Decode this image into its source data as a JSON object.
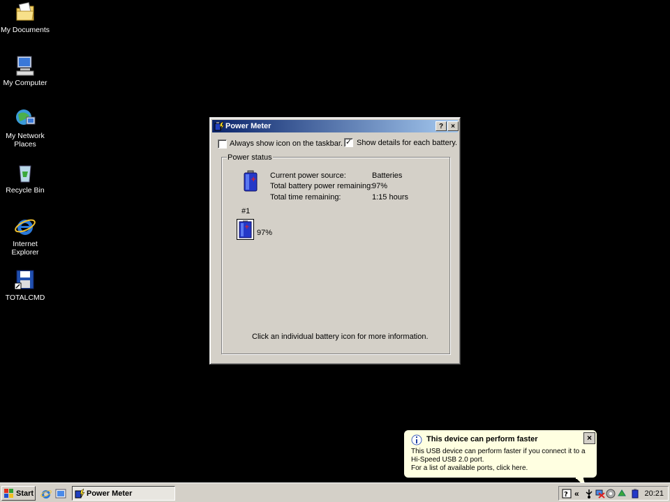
{
  "desktop": {
    "icons": [
      {
        "label": "My Documents"
      },
      {
        "label": "My Computer"
      },
      {
        "label": "My Network Places"
      },
      {
        "label": "Recycle Bin"
      },
      {
        "label": "Internet Explorer"
      },
      {
        "label": "TOTALCMD"
      }
    ]
  },
  "window": {
    "title": "Power Meter",
    "help_btn": "?",
    "close_btn": "×",
    "always_show_label": "Always show icon on the taskbar.",
    "always_show_checked": false,
    "show_details_label": "Show details for each battery.",
    "show_details_checked": true,
    "group_title": "Power status",
    "labels": {
      "source": "Current power source:",
      "remaining": "Total battery power remaining:",
      "time": "Total time remaining:"
    },
    "values": {
      "source": "Batteries",
      "remaining": "97%",
      "time": "1:15 hours"
    },
    "battery": {
      "number": "#1",
      "percent": "97%",
      "level": 0.97
    },
    "footer": "Click an individual battery icon for more information."
  },
  "taskbar": {
    "start_label": "Start",
    "task_label": "Power Meter",
    "tray_chevron": "«",
    "clock": "20:21"
  },
  "balloon": {
    "title": "This device can perform faster",
    "line1": "This USB device can perform faster if you connect it to a",
    "line2": "Hi-Speed USB 2.0 port.",
    "line3": "For a list of available ports, click here.",
    "close": "×"
  },
  "colors": {
    "desktop_bg": "#000000",
    "face": "#d4d0c8",
    "title_start": "#0a246a",
    "title_end": "#a6caf0",
    "balloon_bg": "#ffffe1"
  }
}
